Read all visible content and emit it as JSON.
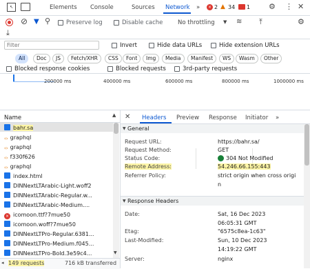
{
  "panel_tabs": [
    "Elements",
    "Console",
    "Sources",
    "Network"
  ],
  "badges": {
    "errors": "2",
    "warnings": "34",
    "issues": "1"
  },
  "toolbar": {
    "preserve_log": "Preserve log",
    "disable_cache": "Disable cache",
    "throttling": "No throttling"
  },
  "filter": {
    "placeholder": "Filter",
    "invert": "Invert",
    "hide_data_urls": "Hide data URLs",
    "hide_extension_urls": "Hide extension URLs"
  },
  "type_filters": [
    "All",
    "Doc",
    "JS",
    "Fetch/XHR",
    "CSS",
    "Font",
    "Img",
    "Media",
    "Manifest",
    "WS",
    "Wasm",
    "Other"
  ],
  "options": {
    "blocked_cookies": "Blocked response cookies",
    "blocked_requests": "Blocked requests",
    "third_party": "3rd-party requests"
  },
  "timeline_ticks": [
    "200000 ms",
    "400000 ms",
    "600000 ms",
    "800000 ms",
    "1000000 ms"
  ],
  "list_header": "Name",
  "requests": [
    {
      "name": "bahr.sa",
      "type": "doc"
    },
    {
      "name": "graphql",
      "type": "xhr"
    },
    {
      "name": "graphql",
      "type": "xhr"
    },
    {
      "name": "f330f626",
      "type": "xhr"
    },
    {
      "name": "graphql",
      "type": "xhr"
    },
    {
      "name": "index.html",
      "type": "doc"
    },
    {
      "name": "DINNextLTArabic-Light.woff2",
      "type": "font"
    },
    {
      "name": "DINNextLTArabic-Regular.w...",
      "type": "font"
    },
    {
      "name": "DINNextLTArabic-Medium....",
      "type": "font"
    },
    {
      "name": "icomoon.ttf?7mue50",
      "type": "err"
    },
    {
      "name": "icomoon.woff?7mue50",
      "type": "font"
    },
    {
      "name": "DINNextLTPro-Regular.6381...",
      "type": "font"
    },
    {
      "name": "DINNextLTPro-Medium.f045...",
      "type": "font"
    },
    {
      "name": "DINNextLTPro-Bold.3e59c4...",
      "type": "font"
    }
  ],
  "status_bar": {
    "requests": "149 requests",
    "transferred": "716 kB transferred"
  },
  "detail_tabs": [
    "Headers",
    "Preview",
    "Response",
    "Initiator"
  ],
  "general": {
    "title": "General",
    "request_url_k": "Request URL:",
    "request_url_v": "https://bahr.sa/",
    "method_k": "Request Method:",
    "method_v": "GET",
    "status_k": "Status Code:",
    "status_v": "304 Not Modified",
    "remote_k": "Remote Address:",
    "remote_v": "54.246.66.155:443",
    "referrer_k": "Referrer Policy:",
    "referrer_v1": "strict origin when cross origi",
    "referrer_v2": "n"
  },
  "response_headers": {
    "title": "Response Headers",
    "date_k": "Date:",
    "date_v1": "Sat, 16 Dec 2023",
    "date_v2": "06:05:31 GMT",
    "etag_k": "Etag:",
    "etag_v": "\"6575c8ea-1c63\"",
    "lastmod_k": "Last-Modified:",
    "lastmod_v1": "Sun, 10 Dec 2023",
    "lastmod_v2": "14:19:22 GMT",
    "server_k": "Server:",
    "server_v": "nginx"
  },
  "colors": {
    "accent": "#0b57d0",
    "error": "#dc362e",
    "warning": "#e37400",
    "status_ok": "#188038",
    "highlight": "#fdf5a6"
  }
}
